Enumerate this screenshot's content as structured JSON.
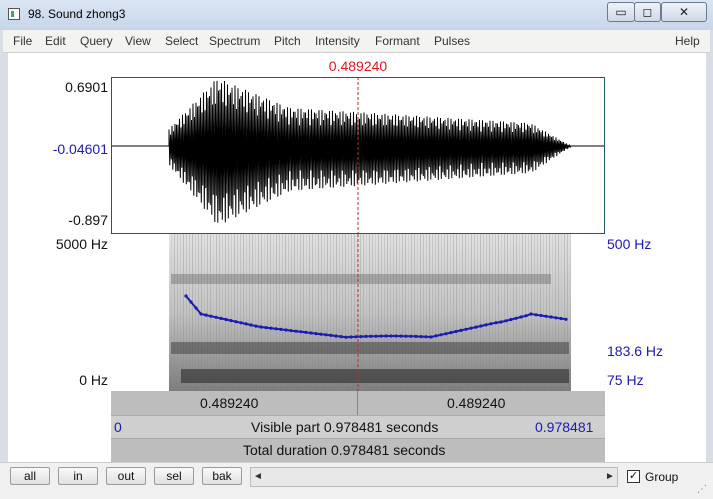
{
  "window": {
    "title": "98. Sound zhong3",
    "minimize": "▭",
    "maximize": "◻",
    "close": "✕"
  },
  "menu": [
    "File",
    "Edit",
    "Query",
    "View",
    "Select",
    "Spectrum",
    "Pitch",
    "Intensity",
    "Formant",
    "Pulses",
    "Help"
  ],
  "waveform": {
    "cursor_time": "0.489240",
    "y_max": "0.6901",
    "y_at_cursor": "-0.04601",
    "y_min": "-0.897"
  },
  "spectrogram": {
    "freq_top": "5000 Hz",
    "freq_bottom": "0 Hz",
    "pitch_top": "500 Hz",
    "pitch_value": "183.6 Hz",
    "pitch_bottom": "75 Hz"
  },
  "time_bar": {
    "left_time": "0.489240",
    "right_time": "0.489240"
  },
  "visible_bar": {
    "start": "0",
    "label": "Visible part 0.978481 seconds",
    "end": "0.978481"
  },
  "total_bar": {
    "label": "Total duration 0.978481 seconds"
  },
  "buttons": {
    "all": "all",
    "in": "in",
    "out": "out",
    "sel": "sel",
    "bak": "bak"
  },
  "scroll": {
    "left_arrow": "◄",
    "right_arrow": "►"
  },
  "group": {
    "label": "Group",
    "checked": "✓"
  },
  "colors": {
    "cursor": "#e8161e",
    "pitch": "#1a1ab4",
    "frame": "#1b5a6e"
  }
}
